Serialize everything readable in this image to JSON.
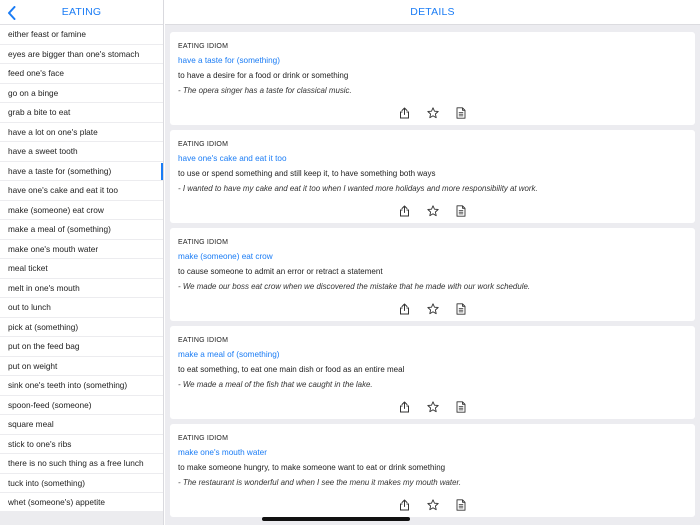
{
  "sidebar": {
    "title": "EATING",
    "items": [
      "either feast or famine",
      "eyes are bigger than one's stomach",
      "feed one's face",
      "go on a binge",
      "grab a bite to eat",
      "have a lot on one's plate",
      "have a sweet tooth",
      "have a taste for (something)",
      "have one's cake and eat it too",
      "make (someone) eat crow",
      "make a meal of (something)",
      "make one's mouth water",
      "meal ticket",
      "melt in one's mouth",
      "out to lunch",
      "pick at (something)",
      "put on the feed bag",
      "put on weight",
      "sink one's teeth into (something)",
      "spoon-feed (someone)",
      "square meal",
      "stick to one's ribs",
      "there is no such thing as a free lunch",
      "tuck into (something)",
      "whet (someone's) appetite"
    ],
    "selected_item": "have a taste for (something)"
  },
  "main": {
    "title": "DETAILS",
    "cards": [
      {
        "type": "EATING IDIOM",
        "idiom": "have a taste for (something)",
        "definition": "to have a desire for a food or drink or something",
        "example": "- The opera singer has a taste for classical music."
      },
      {
        "type": "EATING IDIOM",
        "idiom": "have one's cake and eat it too",
        "definition": "to use or spend something and still keep it, to have something both ways",
        "example": "- I wanted to have my cake and eat it too when I wanted more holidays and more responsibility at work."
      },
      {
        "type": "EATING IDIOM",
        "idiom": "make (someone) eat crow",
        "definition": "to cause someone to admit an error or retract a statement",
        "example": "- We made our boss eat crow when we discovered the mistake that he made with our work schedule."
      },
      {
        "type": "EATING IDIOM",
        "idiom": "make a meal of (something)",
        "definition": "to eat something, to eat one main dish or food as an entire meal",
        "example": "- We made a meal of the fish that we caught in the lake."
      },
      {
        "type": "EATING IDIOM",
        "idiom": "make one's mouth water",
        "definition": "to make someone hungry, to make someone want to eat or drink something",
        "example": "- The restaurant is wonderful and when I see the menu it makes my mouth water."
      }
    ],
    "action_icons": [
      "share-icon",
      "star-icon",
      "document-icon"
    ]
  },
  "colors": {
    "accent": "#1a7cf5",
    "background": "#ececf0"
  }
}
